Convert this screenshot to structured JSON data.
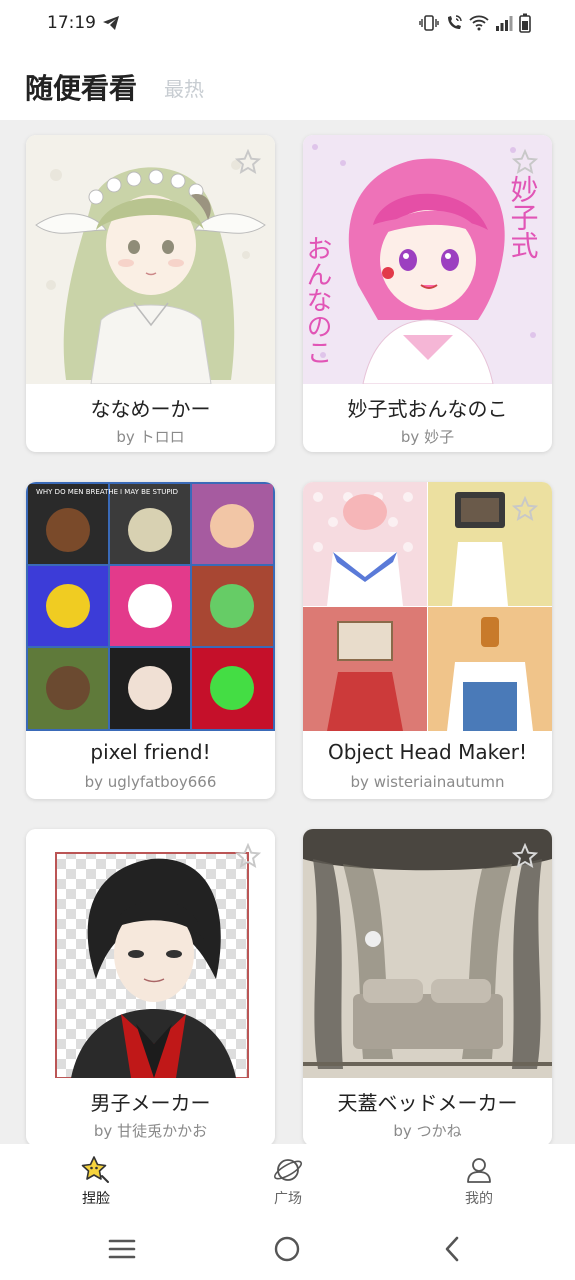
{
  "status_bar": {
    "time": "17:19"
  },
  "header": {
    "tab_active": "随便看看",
    "tab_inactive": "最热"
  },
  "cards": [
    {
      "title": "ななめーかー",
      "author": "by トロロ"
    },
    {
      "title": "妙子式おんなのこ",
      "author": "by 妙子"
    },
    {
      "title": "pixel friend!",
      "author": "by uglyfatboy666"
    },
    {
      "title": "Object Head Maker!",
      "author": "by wisteriainautumn"
    },
    {
      "title": "男子メーカー",
      "author": "by 甘徒兎かかお"
    },
    {
      "title": "天蓋ベッドメーカー",
      "author": "by つかね"
    }
  ],
  "thumb_text": {
    "card1_left": "おんなのこ",
    "card1_right": "妙子式",
    "card2_cap1": "WHY DO MEN BREATHE",
    "card2_cap2": "I MAY BE STUPID"
  },
  "bottom_nav": [
    {
      "label": "捏脸",
      "icon": "star-face-icon"
    },
    {
      "label": "广场",
      "icon": "planet-icon"
    },
    {
      "label": "我的",
      "icon": "person-icon"
    }
  ],
  "colors": {
    "accent": "#f5d33d",
    "background": "#efefef",
    "muted_tab": "#c8cdd2"
  }
}
